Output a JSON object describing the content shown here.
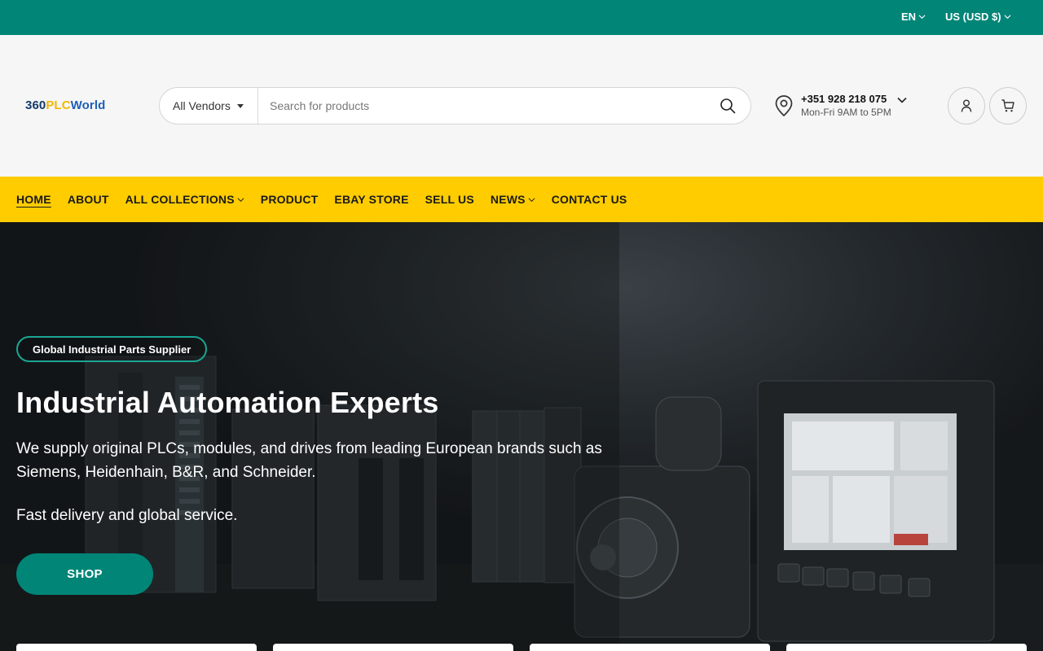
{
  "topbar": {
    "language": "EN",
    "currency": "US (USD $)"
  },
  "header": {
    "logo": {
      "part1": "360",
      "part2": "PLC",
      "part3": "World"
    },
    "search": {
      "vendor_label": "All Vendors",
      "placeholder": "Search for products"
    },
    "contact": {
      "phone": "+351 928 218 075",
      "hours": "Mon-Fri 9AM to 5PM"
    }
  },
  "nav": {
    "items": [
      {
        "label": "HOME"
      },
      {
        "label": "ABOUT"
      },
      {
        "label": "ALL COLLECTIONS"
      },
      {
        "label": "PRODUCT"
      },
      {
        "label": "EBAY STORE"
      },
      {
        "label": "SELL US"
      },
      {
        "label": "NEWS"
      },
      {
        "label": "CONTACT US"
      }
    ]
  },
  "hero": {
    "badge": "Global Industrial Parts Supplier",
    "title": "Industrial Automation Experts",
    "paragraph1": "We supply original PLCs, modules, and drives from leading European brands such as Siemens, Heidenhain, B&R, and Schneider.",
    "paragraph2": "Fast delivery and global service.",
    "cta": "SHOP"
  },
  "colors": {
    "teal": "#008577",
    "yellow": "#ffcc00",
    "logo_blue": "#1d5fb8",
    "logo_gold": "#f2b705"
  }
}
